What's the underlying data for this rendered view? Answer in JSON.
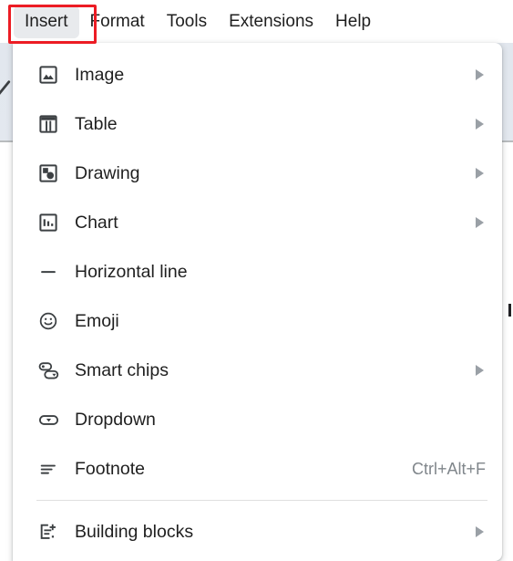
{
  "app": {
    "background_accent": "#e3e8ef",
    "annotation_color": "#ec1c24",
    "menu_highlight": "#e8eaed"
  },
  "menubar": {
    "leading_partial": "",
    "items": [
      {
        "label": "Insert",
        "active": true,
        "name": "menubar-item-insert"
      },
      {
        "label": "Format",
        "active": false,
        "name": "menubar-item-format"
      },
      {
        "label": "Tools",
        "active": false,
        "name": "menubar-item-tools"
      },
      {
        "label": "Extensions",
        "active": false,
        "name": "menubar-item-extensions"
      },
      {
        "label": "Help",
        "active": false,
        "name": "menubar-item-help"
      }
    ]
  },
  "insert_menu": {
    "items": [
      {
        "label": "Image",
        "icon": "image-icon",
        "submenu": true,
        "accel": ""
      },
      {
        "label": "Table",
        "icon": "table-icon",
        "submenu": true,
        "accel": ""
      },
      {
        "label": "Drawing",
        "icon": "drawing-icon",
        "submenu": true,
        "accel": ""
      },
      {
        "label": "Chart",
        "icon": "chart-icon",
        "submenu": true,
        "accel": ""
      },
      {
        "label": "Horizontal line",
        "icon": "horizontal-line-icon",
        "submenu": false,
        "accel": ""
      },
      {
        "label": "Emoji",
        "icon": "emoji-icon",
        "submenu": false,
        "accel": ""
      },
      {
        "label": "Smart chips",
        "icon": "smart-chips-icon",
        "submenu": true,
        "accel": ""
      },
      {
        "label": "Dropdown",
        "icon": "dropdown-icon",
        "submenu": false,
        "accel": ""
      },
      {
        "label": "Footnote",
        "icon": "footnote-icon",
        "submenu": false,
        "accel": "Ctrl+Alt+F"
      },
      {
        "label": "Building blocks",
        "icon": "building-blocks-icon",
        "submenu": true,
        "accel": ""
      }
    ]
  }
}
